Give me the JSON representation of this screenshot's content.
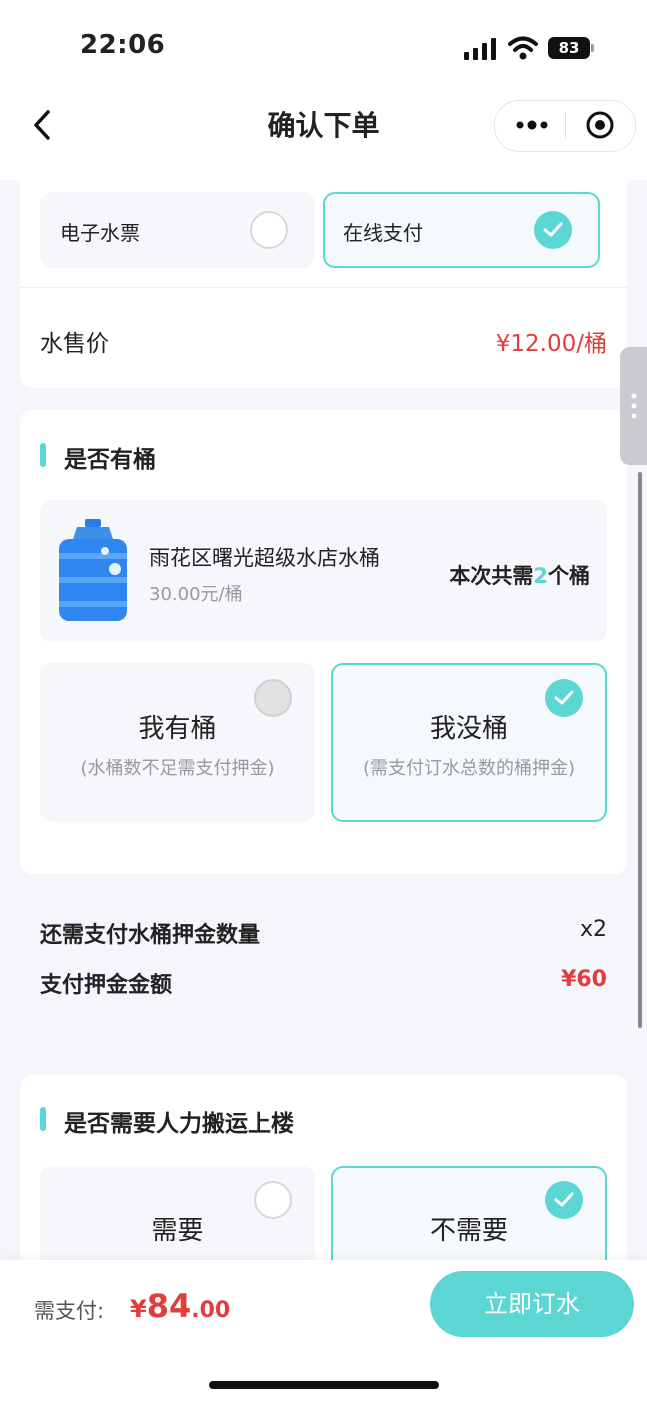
{
  "status_bar": {
    "time": "22:06",
    "battery": "83"
  },
  "nav": {
    "title": "确认下单"
  },
  "payment": {
    "options": [
      {
        "label": "电子水票"
      },
      {
        "label": "在线支付"
      }
    ]
  },
  "price": {
    "label": "水售价",
    "value": "¥12.00/桶"
  },
  "bucket_section": {
    "title": "是否有桶",
    "product": {
      "name": "雨花区曙光超级水店水桶",
      "price": "30.00元/桶",
      "need_prefix": "本次共需",
      "need_count": "2",
      "need_suffix": "个桶"
    },
    "options": [
      {
        "title": "我有桶",
        "subtitle": "(水桶数不足需支付押金)"
      },
      {
        "title": "我没桶",
        "subtitle": "(需支付订水总数的桶押金)"
      }
    ]
  },
  "deposit": {
    "qty_label": "还需支付水桶押金数量",
    "qty_value": "x2",
    "amount_label": "支付押金金额",
    "amount_value": "¥60"
  },
  "carry_section": {
    "title": "是否需要人力搬运上楼",
    "options": [
      {
        "title": "需要"
      },
      {
        "title": "不需要"
      }
    ]
  },
  "footer": {
    "label": "需支付:",
    "currency": "¥",
    "amount_int": "84",
    "amount_dec": ".00",
    "button": "立即订水"
  },
  "colors": {
    "accent": "#5cd6d3",
    "price_red": "#e13d3d"
  }
}
